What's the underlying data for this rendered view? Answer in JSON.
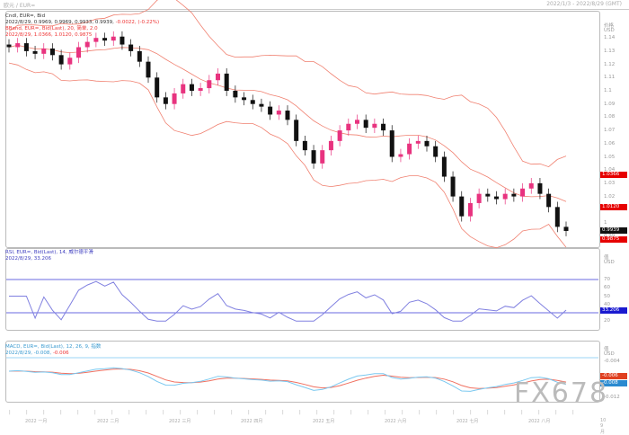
{
  "window": {
    "title": "欧元 / EUR=",
    "range": "2022/1/3 - 2022/8/29 (GMT)"
  },
  "colors": {
    "bull": "#e8337f",
    "bear": "#111111",
    "band": "#f08070",
    "rsi": "#8080e0",
    "rsi_level": "#6a6ae0",
    "macd": "#f07060",
    "signal": "#7ac8f0",
    "tag_red": "#e60000",
    "tag_black": "#111111",
    "tag_blue": "#1a1ad0"
  },
  "main": {
    "legend": [
      "Cndl, EUR=, Bid",
      "2022/8/29, 0.9969, 0.9969, 0.9933, 0.9939,",
      "-0.0022, (-0.22%)",
      "BBand, EUR=, Bid(Last), 20, 简单, 2.0",
      "2022/8/29, 1.0366, 1.0120, 0.9875"
    ],
    "axis_title": "价格",
    "axis_unit": "USD",
    "ticks": [
      "1.14",
      "1.13",
      "1.12",
      "1.11",
      "1.1",
      "1.09",
      "1.08",
      "1.07",
      "1.06",
      "1.05",
      "1.04",
      "1.03",
      "1.02",
      "1.01",
      "1",
      "0.99"
    ],
    "tags": [
      {
        "label": "1.0366",
        "value": 1.0366,
        "color": "red"
      },
      {
        "label": "1.0120",
        "value": 1.012,
        "color": "red"
      },
      {
        "label": "0.9939",
        "value": 0.9939,
        "color": "black"
      },
      {
        "label": "0.9875",
        "value": 0.9875,
        "color": "red"
      }
    ]
  },
  "rsi": {
    "legend": [
      "RSI, EUR=, Bid(Last), 14, 威尔德平滑",
      "2022/8/29, 33.206"
    ],
    "axis_title": "值",
    "axis_unit": "USD",
    "ticks": [
      "70",
      "60",
      "50",
      "40",
      "30",
      "20"
    ],
    "levels": [
      70,
      30
    ],
    "value_tag": "33.206",
    "value": 33.206
  },
  "macd": {
    "legend_a": "MACD, EUR=, Bid(Last), 12, 26, 9, 指数",
    "legend_b": "2022/8/29, -0.008,",
    "legend_c": "-0.006",
    "axis_title": "值",
    "axis_unit": "USD",
    "ticks": [
      "-0.004",
      "-0.012"
    ],
    "tag_macd": "-0.006",
    "tag_signal": "-0.008"
  },
  "xaxis": {
    "months": [
      "2022 一月",
      "2022 二月",
      "2022 三月",
      "2022 四月",
      "2022 五月",
      "2022 六月",
      "2022 七月",
      "2022 八月",
      "10 9月"
    ]
  },
  "watermark": "FX678",
  "chart_data": {
    "type": "candlestick",
    "title": "",
    "ylim": [
      0.98,
      1.145
    ],
    "x_range": [
      "2022/1/3",
      "2022/8/29"
    ],
    "closes": [
      1.133,
      1.136,
      1.13,
      1.128,
      1.132,
      1.127,
      1.12,
      1.125,
      1.133,
      1.137,
      1.14,
      1.138,
      1.141,
      1.135,
      1.13,
      1.122,
      1.11,
      1.095,
      1.09,
      1.098,
      1.105,
      1.1,
      1.102,
      1.108,
      1.113,
      1.1,
      1.095,
      1.093,
      1.09,
      1.088,
      1.082,
      1.085,
      1.078,
      1.062,
      1.055,
      1.045,
      1.055,
      1.062,
      1.07,
      1.075,
      1.078,
      1.072,
      1.075,
      1.07,
      1.05,
      1.052,
      1.06,
      1.062,
      1.058,
      1.05,
      1.035,
      1.02,
      1.005,
      1.015,
      1.022,
      1.02,
      1.018,
      1.022,
      1.02,
      1.026,
      1.03,
      1.022,
      1.012,
      0.997,
      0.9939
    ],
    "last": {
      "open": 0.9969,
      "high": 0.9969,
      "low": 0.9933,
      "close": 0.9939,
      "change": -0.0022,
      "change_pct": -0.22
    },
    "bbands_last": {
      "upper": 1.0366,
      "middle": 1.012,
      "lower": 0.9875
    },
    "rsi_last": 33.206,
    "macd_last": {
      "macd": -0.008,
      "signal": -0.006
    }
  }
}
